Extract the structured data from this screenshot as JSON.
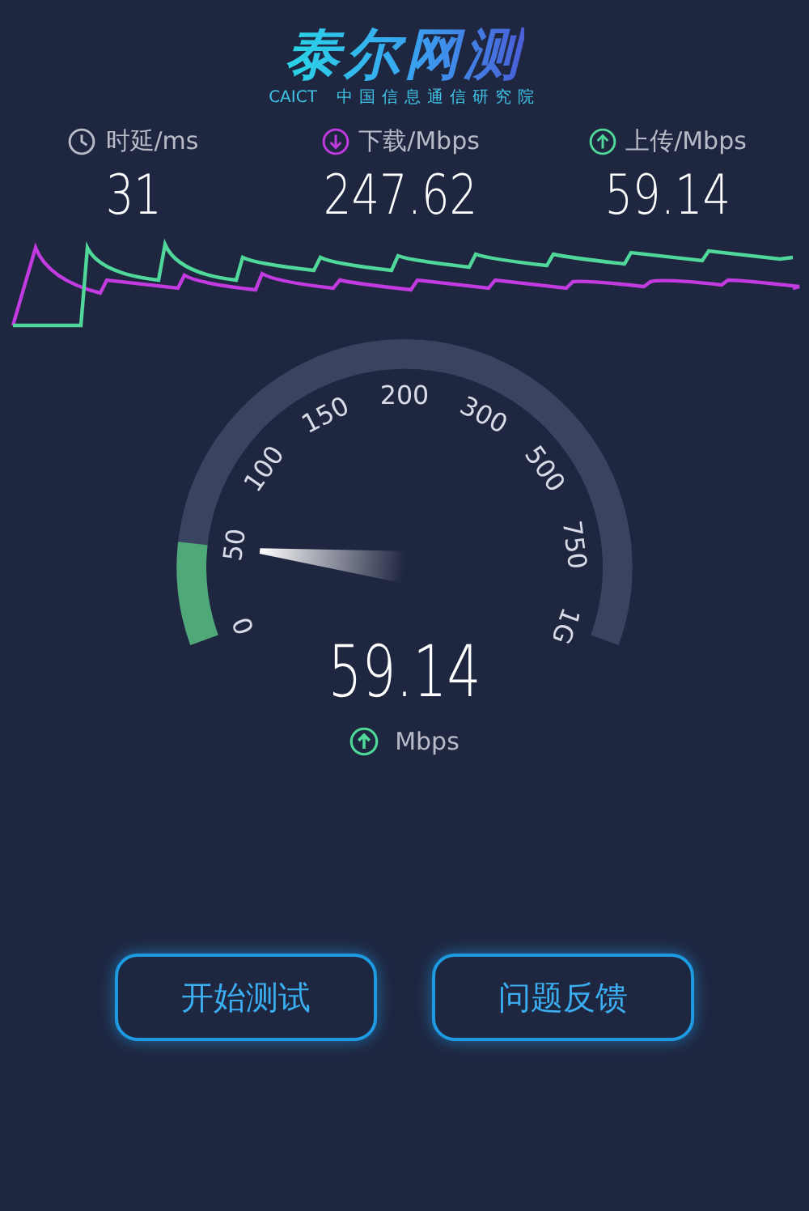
{
  "logo": {
    "title": "泰尔网测",
    "org_code": "CAICT",
    "org_name": "中国信息通信研究院"
  },
  "metrics": [
    {
      "kind": "latency",
      "label": "时延/ms",
      "value": "31"
    },
    {
      "kind": "download",
      "label": "下载/Mbps",
      "value": "247.62"
    },
    {
      "kind": "upload",
      "label": "上传/Mbps",
      "value": "59.14"
    }
  ],
  "gauge": {
    "ticks": [
      "0",
      "50",
      "100",
      "150",
      "200",
      "300",
      "500",
      "750",
      "1G"
    ],
    "value": "59.14",
    "unit": "Mbps"
  },
  "buttons": [
    {
      "label": "开始测试"
    },
    {
      "label": "问题反馈"
    }
  ]
}
